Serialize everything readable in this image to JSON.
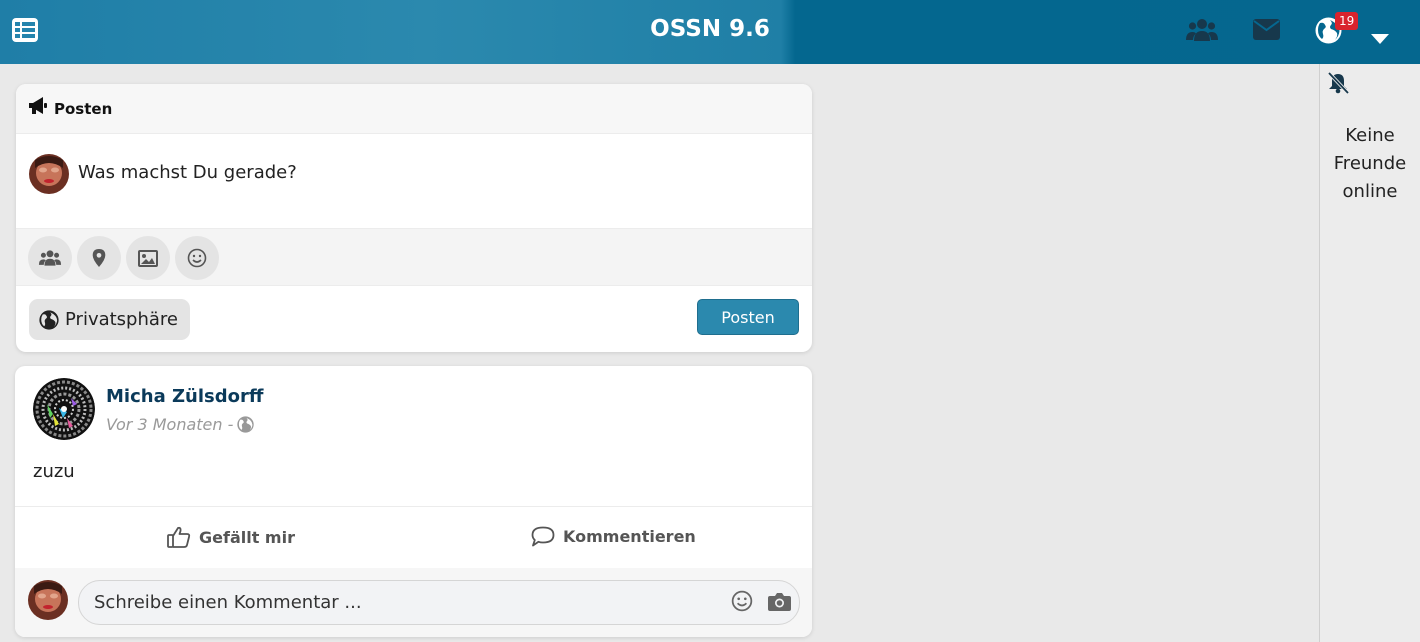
{
  "topbar": {
    "title": "OSSN 9.6",
    "notification_count": "19",
    "icons": [
      "menu-icon",
      "users-icon",
      "envelope-icon",
      "globe-icon",
      "caret-down-icon"
    ]
  },
  "sidebar": {
    "empty_text": "Keine Freunde online"
  },
  "composer": {
    "header_label": "Posten",
    "placeholder": "Was machst Du gerade?",
    "tools": [
      "users-icon",
      "map-marker-icon",
      "image-icon",
      "smile-icon"
    ],
    "privacy_label": "Privatsphäre",
    "post_button": "Posten"
  },
  "post": {
    "author": "Micha Zülsdorff",
    "time": "Vor 3 Monaten -",
    "text": "zuzu",
    "like_label": "Gefällt mir",
    "comment_label": "Kommentieren",
    "comment_placeholder": "Schreibe einen Kommentar ..."
  },
  "colors": {
    "topbar": "#2b89ae",
    "topbar_dark": "#05678f",
    "badge": "#d9232d",
    "author": "#0b3a5a",
    "post_button": "#2b89ae"
  }
}
